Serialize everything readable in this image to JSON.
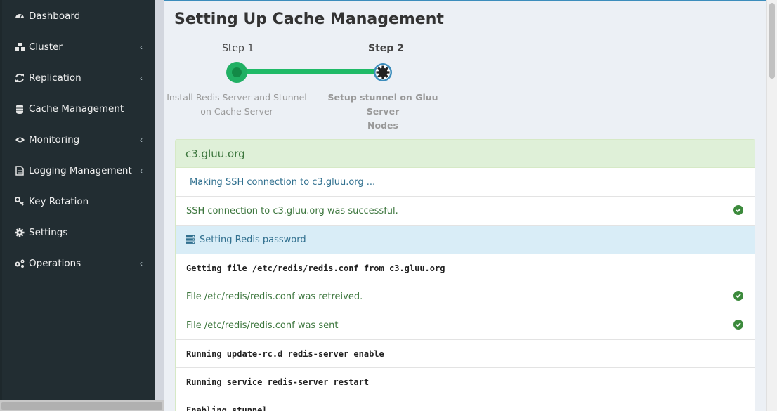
{
  "sidebar": {
    "items": [
      {
        "label": "Dashboard",
        "icon": "dashboard-icon",
        "has_children": false
      },
      {
        "label": "Cluster",
        "icon": "cluster-icon",
        "has_children": true
      },
      {
        "label": "Replication",
        "icon": "refresh-icon",
        "has_children": true
      },
      {
        "label": "Cache Management",
        "icon": "database-icon",
        "has_children": false
      },
      {
        "label": "Monitoring",
        "icon": "eye-icon",
        "has_children": true
      },
      {
        "label": "Logging Management",
        "icon": "file-icon",
        "has_children": true
      },
      {
        "label": "Key Rotation",
        "icon": "key-icon",
        "has_children": false
      },
      {
        "label": "Settings",
        "icon": "gear-icon",
        "has_children": false
      },
      {
        "label": "Operations",
        "icon": "gears-icon",
        "has_children": true
      }
    ]
  },
  "page": {
    "title": "Setting Up Cache Management"
  },
  "wizard": {
    "step1": {
      "label": "Step 1",
      "desc_line1": "Install Redis Server and Stunnel",
      "desc_line2": "on Cache Server"
    },
    "step2": {
      "label": "Step 2",
      "desc_line1": "Setup stunnel on Gluu Server",
      "desc_line2": "Nodes"
    }
  },
  "panel": {
    "title": "c3.gluu.org",
    "rows": [
      {
        "text": "Making SSH connection to c3.gluu.org ...",
        "style": "info-blue"
      },
      {
        "text": "SSH connection to c3.gluu.org was successful.",
        "style": "success",
        "check": true
      },
      {
        "text": "Setting Redis password",
        "style": "section"
      },
      {
        "text": "Getting file /etc/redis/redis.conf from c3.gluu.org",
        "style": "mono"
      },
      {
        "text": "File /etc/redis/redis.conf was retreived.",
        "style": "success",
        "check": true
      },
      {
        "text": "File /etc/redis/redis.conf was sent",
        "style": "success",
        "check": true
      },
      {
        "text": "Running update-rc.d redis-server enable",
        "style": "mono"
      },
      {
        "text": "Running service redis-server restart",
        "style": "mono"
      },
      {
        "text": "Enabling stunnel",
        "style": "mono"
      }
    ]
  },
  "colors": {
    "sidebar_bg": "#222d32",
    "step_green": "#1fba67",
    "step_active": "#3c8dbc",
    "success_text": "#3c763d",
    "info_text": "#31708f"
  }
}
